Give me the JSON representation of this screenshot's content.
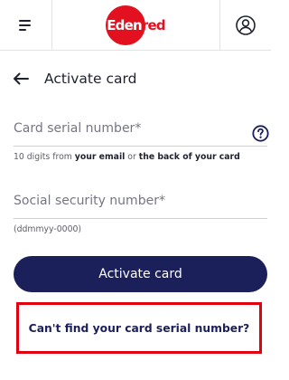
{
  "header": {
    "menu_icon": "hamburger-menu-icon",
    "logo": {
      "part1": "Eden",
      "part2": "red",
      "color": "#e3101f"
    },
    "profile_icon": "user-profile-icon"
  },
  "page": {
    "back_icon": "arrow-left-icon",
    "title": "Activate card"
  },
  "form": {
    "serial": {
      "label": "Card serial number",
      "required_mark": "*",
      "value": "",
      "help_icon": "question-mark-icon",
      "helper_prefix": "10 digits from ",
      "helper_bold1": "your email",
      "helper_mid": " or ",
      "helper_bold2": "the back of your card"
    },
    "ssn": {
      "label": "Social security number",
      "required_mark": "*",
      "value": "",
      "helper": "(ddmmyy-0000)"
    }
  },
  "actions": {
    "activate_label": "Activate card",
    "cant_find_link": "Can't find your card serial number?"
  },
  "colors": {
    "primary": "#1b1f5a",
    "brand_red": "#e3101f",
    "highlight": "#e2000f"
  }
}
